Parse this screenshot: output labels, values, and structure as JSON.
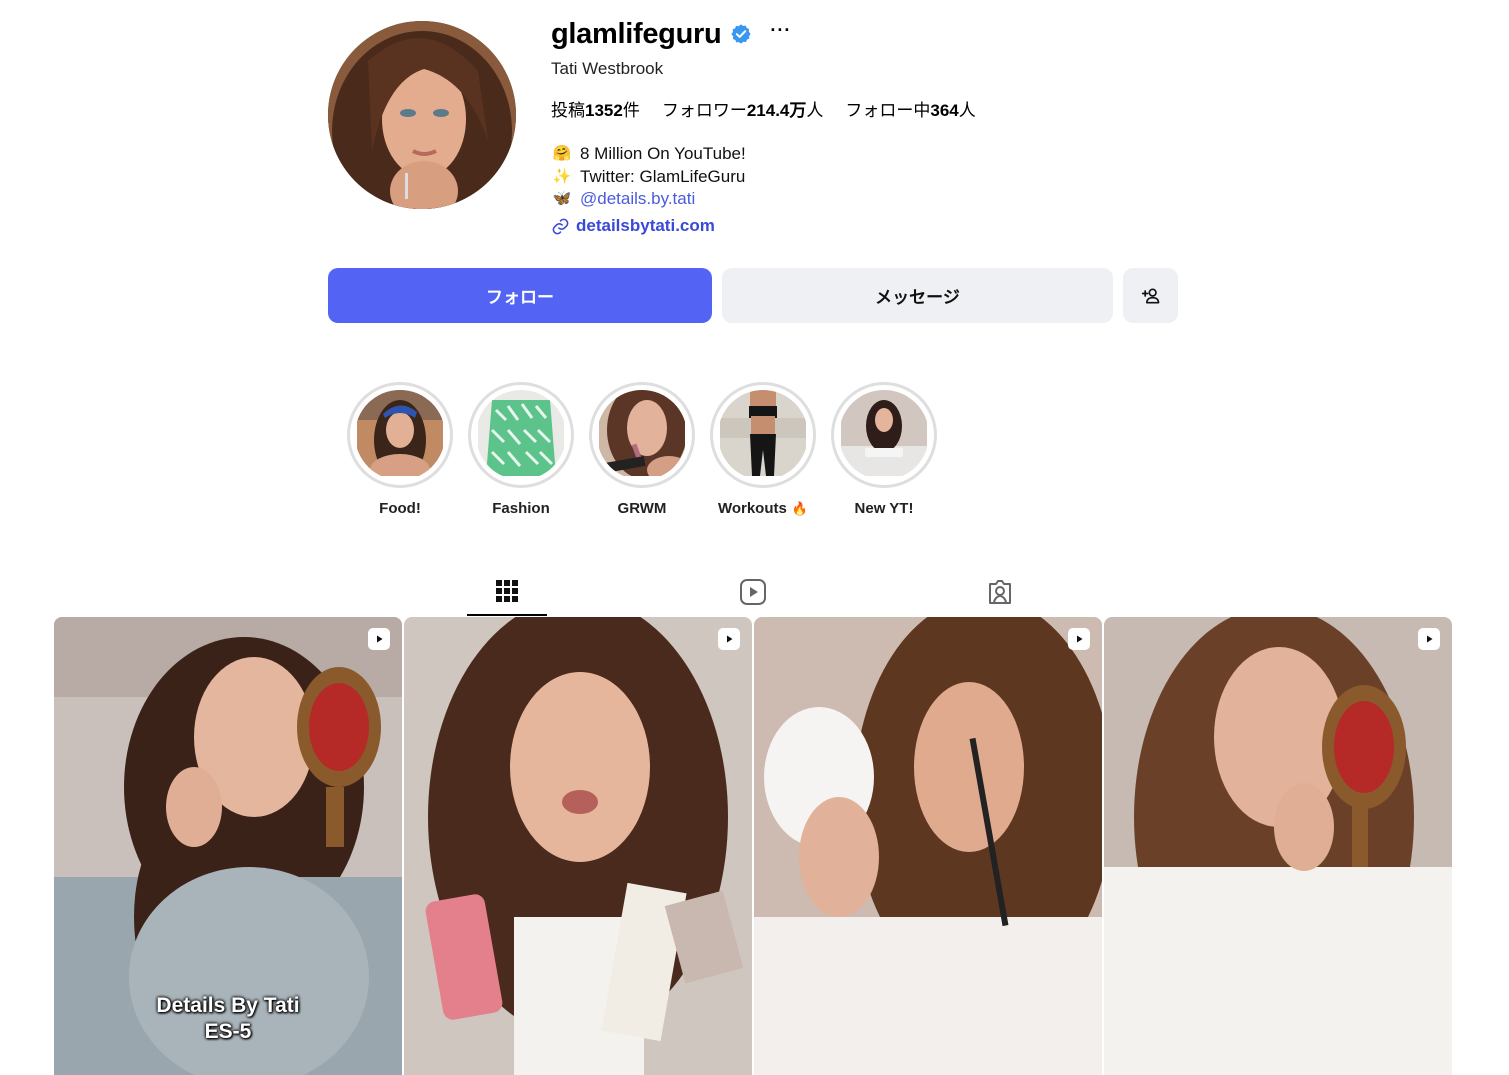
{
  "profile": {
    "username": "glamlifeguru",
    "full_name": "Tati Westbrook",
    "more_label": "···",
    "stats": {
      "posts_label": "投稿",
      "posts_value": "1352",
      "posts_unit": "件",
      "followers_label": "フォロワー",
      "followers_value": "214.4万",
      "followers_unit": "人",
      "following_label": "フォロー中",
      "following_value": "364",
      "following_unit": "人"
    },
    "bio": {
      "line1_emoji": "🤗",
      "line1": "8 Million On YouTube!",
      "line2_emoji": "✨",
      "line2": "Twitter: GlamLifeGuru",
      "line3_emoji": "🦋",
      "line3": "@details.by.tati"
    },
    "link": "detailsbytati.com"
  },
  "actions": {
    "follow": "フォロー",
    "message": "メッセージ"
  },
  "highlights": [
    {
      "label": "Food!"
    },
    {
      "label": "Fashion"
    },
    {
      "label": "GRWM"
    },
    {
      "label": "Workouts",
      "emoji": "🔥"
    },
    {
      "label": "New YT!"
    }
  ],
  "posts": [
    {
      "caption_line1": "Details By Tati",
      "caption_line2": "ES-5"
    },
    {},
    {},
    {}
  ],
  "colors": {
    "accent": "#5364f5",
    "link": "#3a4ad8",
    "verified": "#3897f0"
  }
}
